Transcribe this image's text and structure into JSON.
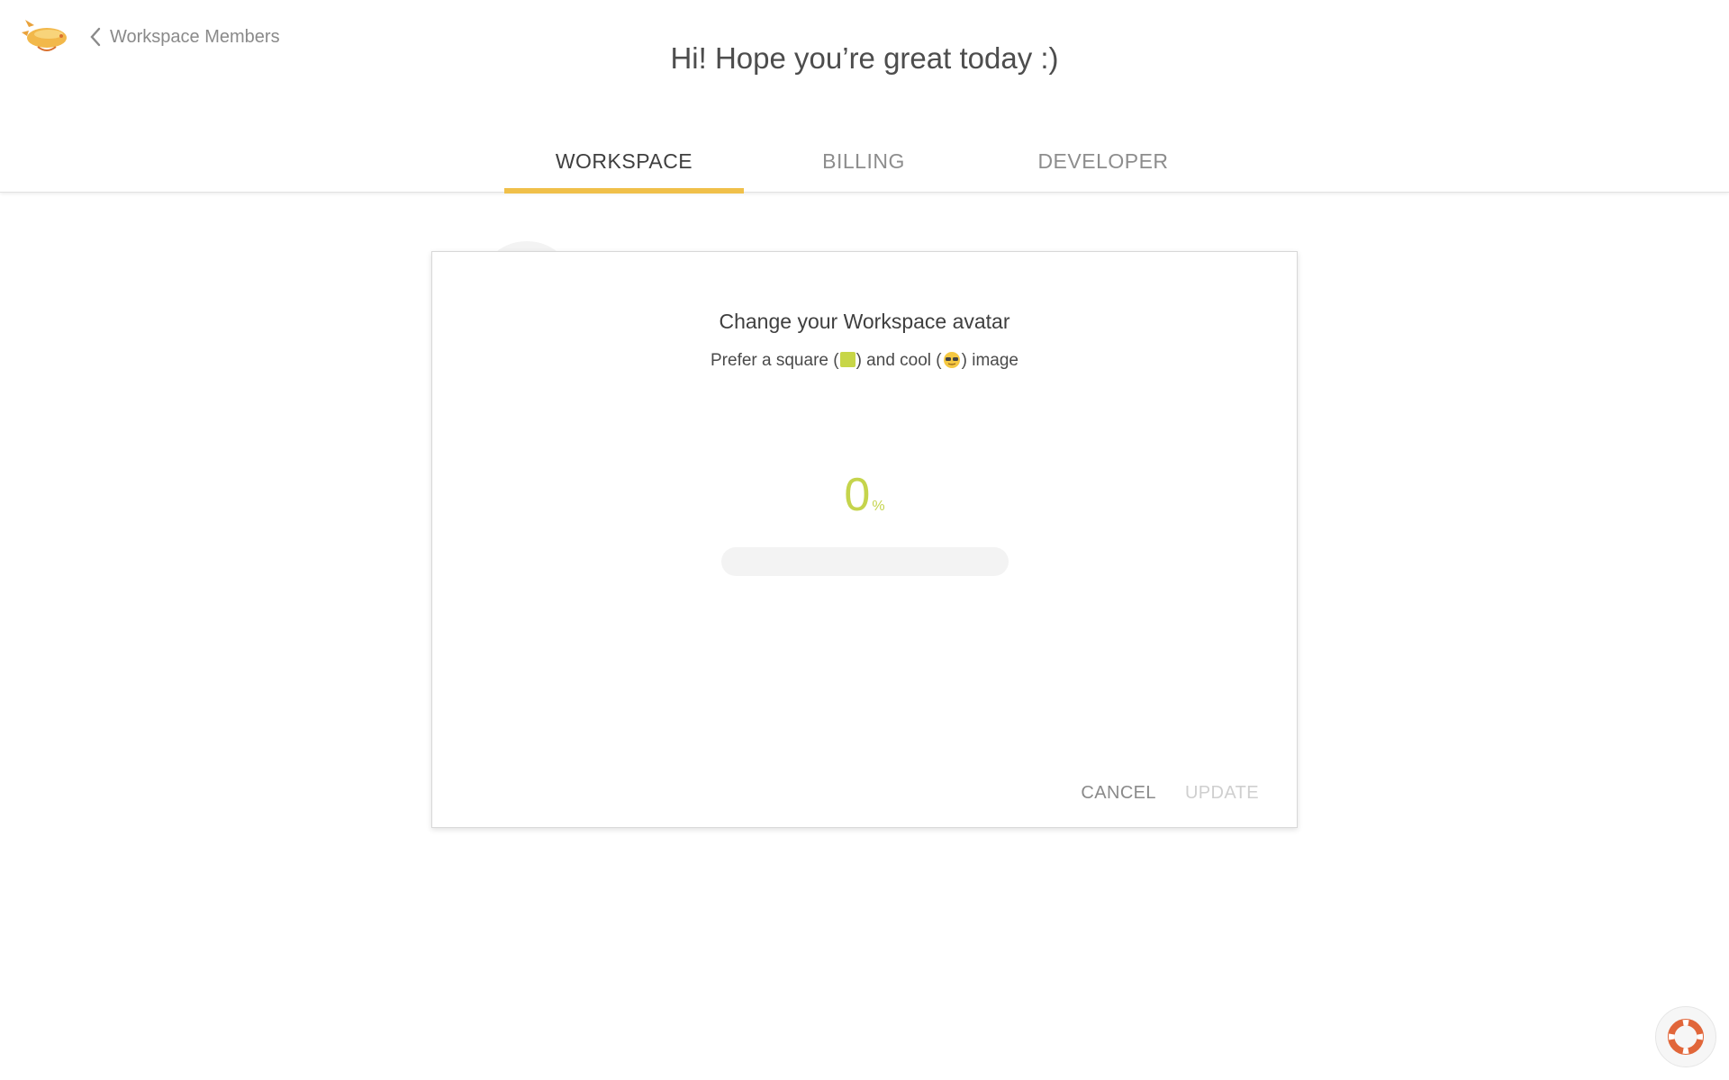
{
  "header": {
    "back_label": "Workspace Members",
    "greeting": "Hi! Hope you’re great today :)",
    "logo_icon": "zeppelin-logo-icon"
  },
  "tabs": [
    {
      "label": "WORKSPACE",
      "active": true
    },
    {
      "label": "BILLING",
      "active": false
    },
    {
      "label": "DEVELOPER",
      "active": false
    }
  ],
  "dialog": {
    "title": "Change your Workspace avatar",
    "subtitle_part1": "Prefer a square (",
    "subtitle_part2": ") and cool (",
    "subtitle_part3": ") image",
    "progress_value": "0",
    "progress_unit": "%",
    "progress_fraction": 0,
    "cancel_label": "CANCEL",
    "update_label": "UPDATE"
  },
  "help": {
    "icon": "lifebuoy-icon"
  },
  "colors": {
    "accent_tab": "#f0c04a",
    "progress": "#c5d44c",
    "help_icon": "#e1663a"
  }
}
